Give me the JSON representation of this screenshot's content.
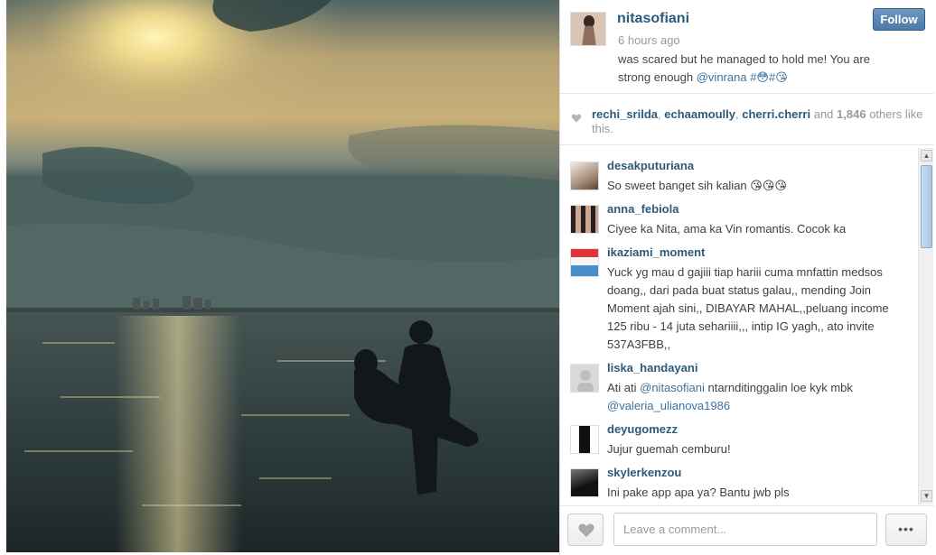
{
  "post": {
    "username": "nitasofiani",
    "time": "6 hours ago",
    "caption_text": "was scared but he managed to hold me! You are strong enough ",
    "caption_mention": "@vinrana",
    "caption_tags": "#😳#😘",
    "follow_label": "Follow"
  },
  "likes": {
    "likers": [
      "rechi_srilda",
      "echaamoully",
      "cherri.cherri"
    ],
    "sep": ", ",
    "and": " and ",
    "count": "1,846",
    "suffix": " others like this."
  },
  "comments": [
    {
      "user": "desakputuriana",
      "text": "So sweet banget sih kalian 😘😘😘"
    },
    {
      "user": "anna_febiola",
      "text": "Ciyee ka Nita, ama ka Vin romantis. Cocok ka"
    },
    {
      "user": "ikaziami_moment",
      "text": "Yuck yg mau d gajiii tiap hariii cuma mnfattin medsos doang,, dari pada buat status galau,, mending Join Moment ajah sini,, DIBAYAR MAHAL,,peluang income 125 ribu - 14 juta sehariiii,,, intip IG yagh,, ato invite 537A3FBB,,"
    },
    {
      "user": "liska_handayani",
      "text_before": "Ati ati ",
      "mention1": "@nitasofiani",
      "text_mid": " ntarnditinggalin loe kyk mbk ",
      "mention2": "@valeria_ulianova1986"
    },
    {
      "user": "deyugomezz",
      "text": "Jujur guemah cemburu!"
    },
    {
      "user": "skylerkenzou",
      "text": "Ini pake app apa ya? Bantu jwb pls"
    }
  ],
  "footer": {
    "comment_placeholder": "Leave a comment...",
    "more_label": "•••"
  },
  "icons": {
    "heart": "heart-icon",
    "more": "ellipsis-icon",
    "scroll_up": "▲",
    "scroll_down": "▼"
  },
  "colors": {
    "username": "#2d5a7b",
    "follow": "#4d7aa7",
    "mention": "#3f729b"
  }
}
